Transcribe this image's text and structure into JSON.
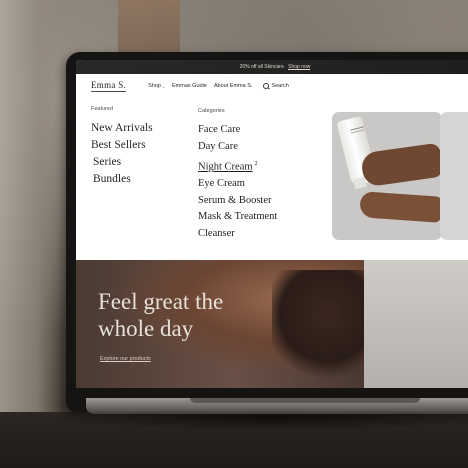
{
  "announcement": {
    "text": "20% off all Skincare.",
    "link": "Shop now"
  },
  "header": {
    "logo": "Emma S.",
    "nav": [
      {
        "label": "Shop",
        "has_dropdown": true
      },
      {
        "label": "Emmas Guide"
      },
      {
        "label": "About Emma S."
      }
    ],
    "search_label": "Search"
  },
  "mega_menu": {
    "featured_heading": "Featured",
    "featured": [
      "New Arrivals",
      "Best Sellers",
      "Series",
      "Bundles"
    ],
    "categories_heading": "Categories",
    "categories": [
      {
        "label": "Face Care"
      },
      {
        "label": "Day Care"
      },
      {
        "label": "Night Cream",
        "badge": "2",
        "active": true
      },
      {
        "label": "Eye Cream"
      },
      {
        "label": "Serum & Booster"
      },
      {
        "label": "Mask & Treatment"
      },
      {
        "label": "Cleanser"
      }
    ]
  },
  "hero": {
    "headline_line1": "Feel great the",
    "headline_line2": "whole day",
    "cta": "Explore our products"
  },
  "colors": {
    "announcement_bg": "#1d1c1b",
    "text": "#1f1f1f",
    "promo_bg": "#c9c8c6",
    "hero_text": "#e6e0da"
  }
}
